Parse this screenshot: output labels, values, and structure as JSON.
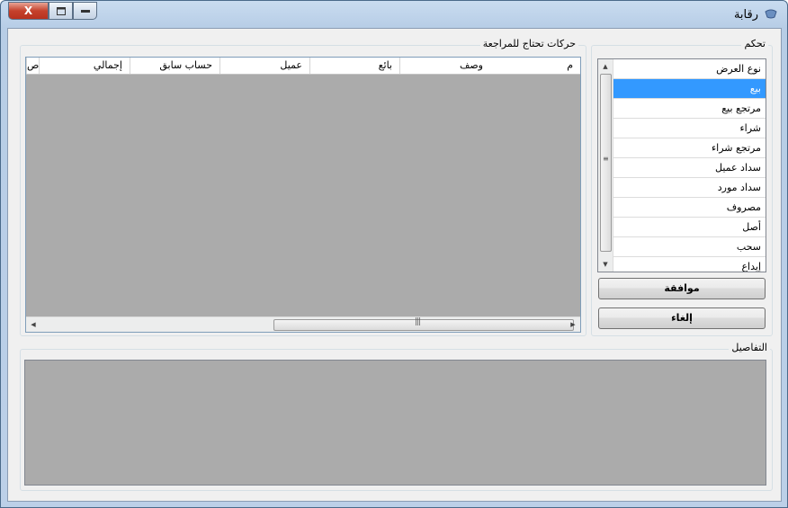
{
  "window": {
    "title": "رقابة",
    "close_glyph": "X",
    "max_glyph": "▭",
    "min_glyph": "▬"
  },
  "control": {
    "group_title": "تحكم",
    "list_header": "نوع العرض",
    "items": [
      "بيع",
      "مرتجع بيع",
      "شراء",
      "مرتجع شراء",
      "سداد عميل",
      "سداد مورد",
      "مصروف",
      "أصل",
      "سحب",
      "إيداع"
    ],
    "selected_index": 0,
    "ok_label": "موافقة",
    "cancel_label": "إلغاء"
  },
  "review": {
    "group_title": "حركات تحتاج للمراجعة",
    "columns": [
      "م",
      "وصف",
      "بائع",
      "عميل",
      "حساب سابق",
      "إجمالي",
      "ص"
    ]
  },
  "details": {
    "group_title": "التفاصيل"
  },
  "icons": {
    "scroll_up": "up-arrow-icon",
    "scroll_down": "down-arrow-icon",
    "scroll_left": "left-arrow-icon",
    "scroll_right": "right-arrow-icon"
  }
}
